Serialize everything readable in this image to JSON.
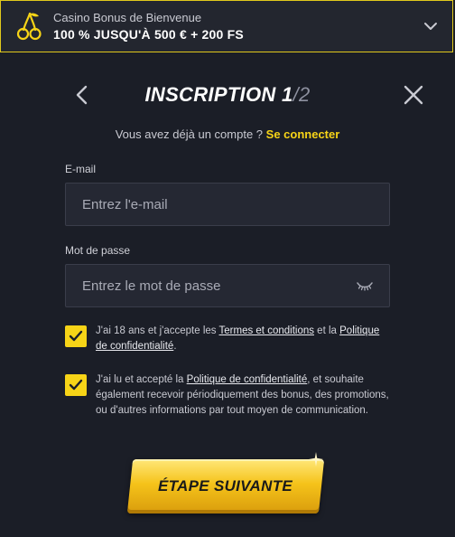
{
  "bonus": {
    "subtitle": "Casino Bonus de Bienvenue",
    "headline": "100 % JUSQU'À 500 € + 200 FS",
    "icon": "cherry-icon",
    "accent": "#f7d417"
  },
  "header": {
    "title": "INSCRIPTION",
    "step_current": "1",
    "step_total": "/2"
  },
  "login": {
    "prompt": "Vous avez déjà un compte ?",
    "link": "Se connecter"
  },
  "email": {
    "label": "E-mail",
    "placeholder": "Entrez l'e-mail",
    "value": ""
  },
  "password": {
    "label": "Mot de passe",
    "placeholder": "Entrez le mot de passe",
    "value": ""
  },
  "consents": [
    {
      "checked": true,
      "text_before": "J'ai 18 ans et j'accepte les ",
      "link1": "Termes et conditions",
      "text_middle": " et la ",
      "link2": "Politique de confidentialité",
      "text_after": "."
    },
    {
      "checked": true,
      "text_before": "J'ai lu et accepté la ",
      "link1": "Politique de confidentialité",
      "text_after": ", et souhaite également recevoir périodiquement des bonus, des promotions, ou d'autres informations par tout moyen de communication."
    }
  ],
  "next_button": {
    "label": "ÉTAPE SUIVANTE"
  }
}
